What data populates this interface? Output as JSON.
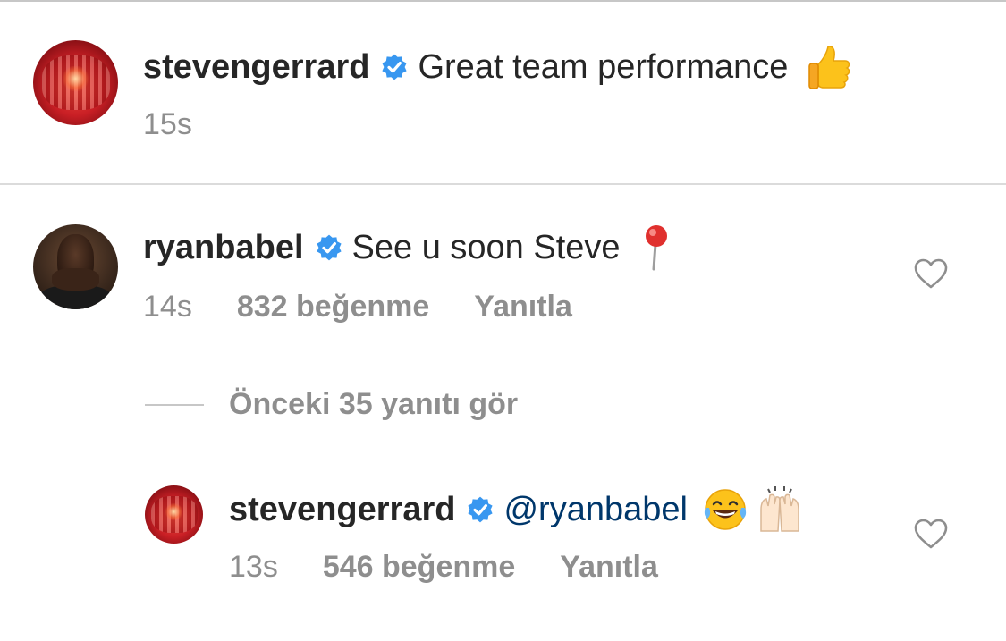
{
  "comments": [
    {
      "username": "stevengerrard",
      "text": "Great team performance",
      "time": "15s"
    },
    {
      "username": "ryanbabel",
      "text": "See u soon Steve",
      "time": "14s",
      "likes": "832 beğenme",
      "reply": "Yanıtla"
    }
  ],
  "view_previous": "Önceki 35 yanıtı gör",
  "reply": {
    "username": "stevengerrard",
    "mention": "@ryanbabel",
    "time": "13s",
    "likes": "546 beğenme",
    "reply": "Yanıtla"
  },
  "colors": {
    "verified": "#3897f0",
    "mention": "#00376b",
    "meta": "#8e8e8e"
  },
  "icons": [
    "verified-badge-icon",
    "heart-outline-icon",
    "thumbs-up-emoji",
    "round-pushpin-emoji",
    "tears-of-joy-emoji",
    "raising-hands-emoji"
  ]
}
